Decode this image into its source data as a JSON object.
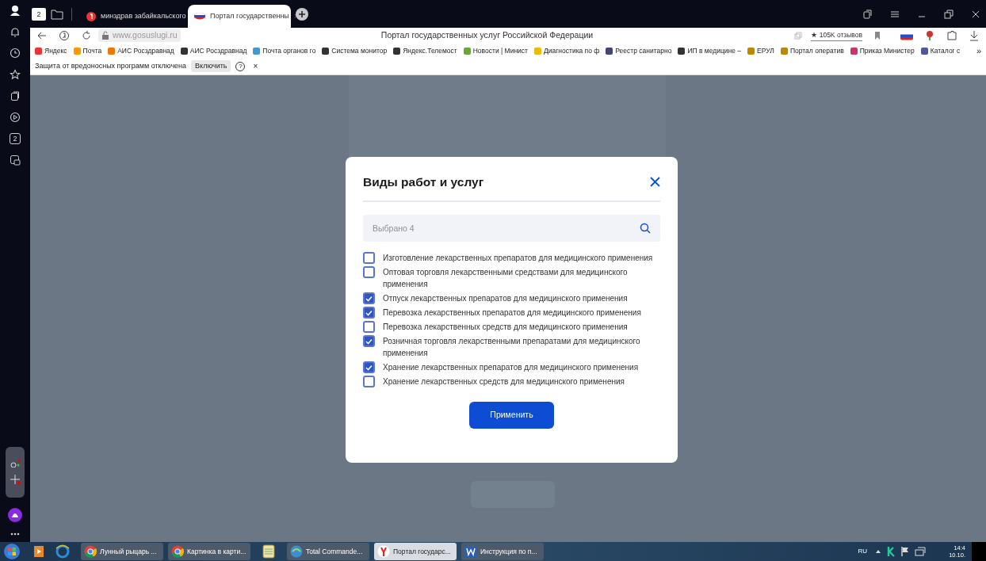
{
  "browser": {
    "home_tab_count": "2",
    "tabs": [
      {
        "label": "минздрав забайкальского",
        "selected": false
      },
      {
        "label": "Портал государственны",
        "selected": true
      }
    ],
    "address": "www.gosuslugi.ru",
    "page_title": "Портал государственных услуг Российской Федерации",
    "reviews": "★ 105K отзывов",
    "bookmarks": [
      "Яндекс",
      "Почта",
      "АИС Росздравнад",
      "АИС Росздравнад",
      "Почта органов го",
      "Система монитор",
      "Яндекс.Телемост",
      "Новости | Минист",
      "Диагностика по ф",
      "Реестр санитарно",
      "ИП в медицине –",
      "ЕРУЛ",
      "Портал оператив",
      "Приказ Министер",
      "Каталог с"
    ],
    "more_bookmarks": "»",
    "protection": {
      "text": "Защита от вредоносных программ отключена",
      "button": "Включить",
      "help": "?",
      "close": "×"
    },
    "sidebar_counter": "2"
  },
  "modal": {
    "title": "Виды работ и услуг",
    "search": {
      "placeholder": "Выбрано 4"
    },
    "options": [
      {
        "label": "Изготовление лекарственных препаратов для медицинского применения",
        "checked": false
      },
      {
        "label": "Оптовая торговля лекарственными средствами для медицинского применения",
        "checked": false
      },
      {
        "label": "Отпуск лекарственных препаратов для медицинского применения",
        "checked": true
      },
      {
        "label": "Перевозка лекарственных препаратов для медицинского применения",
        "checked": true
      },
      {
        "label": "Перевозка лекарственных средств для медицинского применения",
        "checked": false
      },
      {
        "label": "Розничная торговля лекарственными препаратами для медицинского применения",
        "checked": true
      },
      {
        "label": "Хранение лекарственных препаратов для медицинского применения",
        "checked": true
      },
      {
        "label": "Хранение лекарственных средств для медицинского применения",
        "checked": false
      }
    ],
    "apply": "Применить"
  },
  "taskbar": {
    "items": [
      {
        "label": "Лунный рыцарь ...",
        "kind": "chrome",
        "selected": false
      },
      {
        "label": "Картинка в карти...",
        "kind": "chrome",
        "selected": false
      },
      {
        "label": "Total Commande...",
        "kind": "commander",
        "selected": false
      },
      {
        "label": "Портал государс...",
        "kind": "yandex",
        "selected": true
      },
      {
        "label": "Инструкция по п...",
        "kind": "word",
        "selected": false
      }
    ],
    "lang": "RU",
    "time": "14:4",
    "date": "10.10."
  }
}
